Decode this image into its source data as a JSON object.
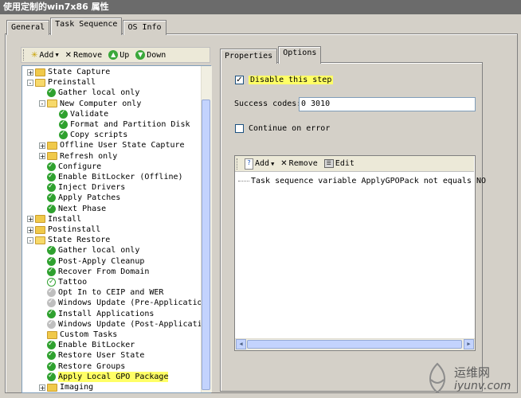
{
  "window": {
    "title": "使用定制的win7x86 属性"
  },
  "main_tabs": [
    {
      "label": "General"
    },
    {
      "label": "Task Sequence"
    },
    {
      "label": "OS Info"
    }
  ],
  "toolbar": {
    "add": "Add",
    "remove": "Remove",
    "up": "Up",
    "down": "Down"
  },
  "tree": [
    {
      "label": "State Capture",
      "type": "folder"
    },
    {
      "label": "Preinstall",
      "type": "folder"
    },
    {
      "label": "Gather local only",
      "type": "ok"
    },
    {
      "label": "New Computer only",
      "type": "folder"
    },
    {
      "label": "Validate",
      "type": "ok"
    },
    {
      "label": "Format and Partition Disk",
      "type": "ok"
    },
    {
      "label": "Copy scripts",
      "type": "ok"
    },
    {
      "label": "Offline User State Capture",
      "type": "folder"
    },
    {
      "label": "Refresh only",
      "type": "folder"
    },
    {
      "label": "Configure",
      "type": "ok"
    },
    {
      "label": "Enable BitLocker (Offline)",
      "type": "ok"
    },
    {
      "label": "Inject Drivers",
      "type": "ok"
    },
    {
      "label": "Apply Patches",
      "type": "ok"
    },
    {
      "label": "Next Phase",
      "type": "ok"
    },
    {
      "label": "Install",
      "type": "folder"
    },
    {
      "label": "Postinstall",
      "type": "folder"
    },
    {
      "label": "State Restore",
      "type": "folder"
    },
    {
      "label": "Gather local only",
      "type": "ok"
    },
    {
      "label": "Post-Apply Cleanup",
      "type": "ok"
    },
    {
      "label": "Recover From Domain",
      "type": "ok"
    },
    {
      "label": "Tattoo",
      "type": "okw"
    },
    {
      "label": "Opt In to CEIP and WER",
      "type": "grey"
    },
    {
      "label": "Windows Update (Pre-Applicatio",
      "type": "grey"
    },
    {
      "label": "Install Applications",
      "type": "ok"
    },
    {
      "label": "Windows Update (Post-Applicati",
      "type": "grey"
    },
    {
      "label": "Custom Tasks",
      "type": "folder"
    },
    {
      "label": "Enable BitLocker",
      "type": "ok"
    },
    {
      "label": "Restore User State",
      "type": "ok"
    },
    {
      "label": "Restore Groups",
      "type": "ok"
    },
    {
      "label": "Apply Local GPO Package",
      "type": "ok",
      "highlighted": true
    },
    {
      "label": "Imaging",
      "type": "folder"
    }
  ],
  "right_tabs": [
    {
      "label": "Properties"
    },
    {
      "label": "Options"
    }
  ],
  "options": {
    "disable_step_label": "Disable this step",
    "disable_step_checked": true,
    "success_codes_label": "Success codes:",
    "success_codes_value": "0 3010",
    "continue_on_error_label": "Continue on error",
    "continue_on_error_checked": false
  },
  "conditions": {
    "add": "Add",
    "remove": "Remove",
    "edit": "Edit",
    "items": [
      {
        "text": "Task sequence variable ApplyGPOPack not equals NO"
      }
    ]
  },
  "watermark": {
    "cn": "运维网",
    "en": "iyunv.com"
  },
  "colors": {
    "highlight": "#ffff66",
    "ok_icon": "#2fa12f",
    "grey_icon": "#bfbfbf",
    "folder": "#f0c94a"
  }
}
